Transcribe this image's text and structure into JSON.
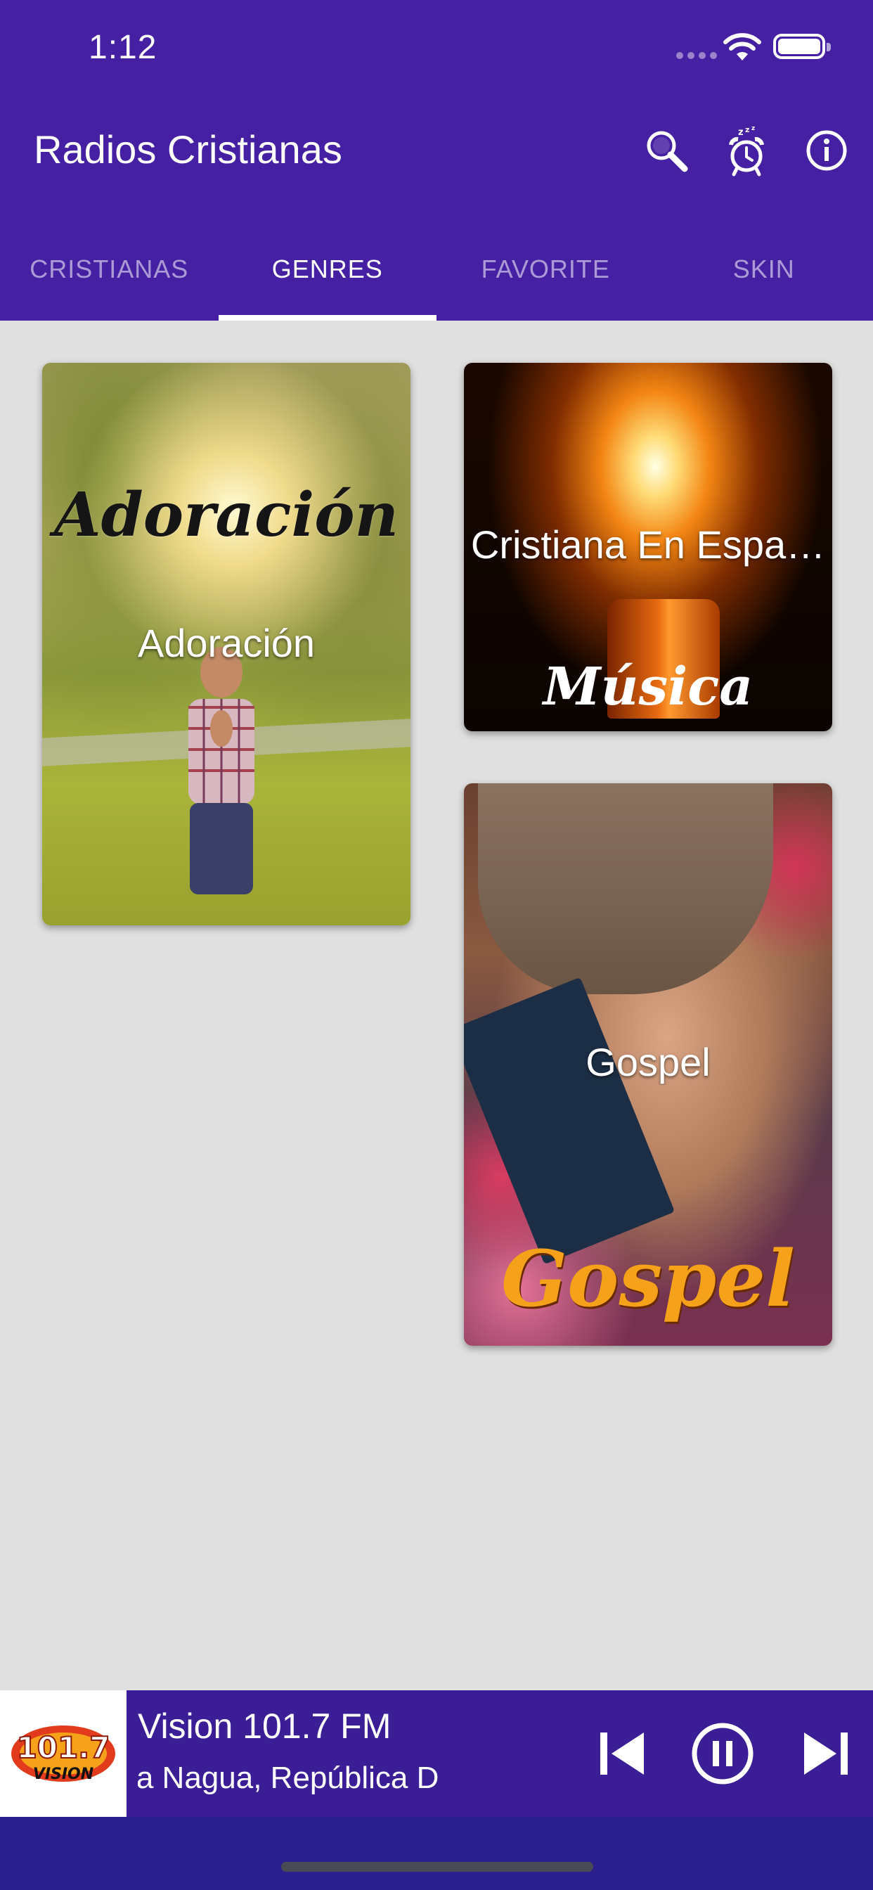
{
  "status_bar": {
    "time": "1:12"
  },
  "app_bar": {
    "title": "Radios Cristianas",
    "icons": [
      "search-icon",
      "sleep-timer-icon",
      "info-icon"
    ]
  },
  "tabs": [
    {
      "label": "CRISTIANAS",
      "active": false
    },
    {
      "label": "GENRES",
      "active": true
    },
    {
      "label": "FAVORITE",
      "active": false
    },
    {
      "label": "SKIN",
      "active": false
    }
  ],
  "genres": [
    {
      "label": "Adoración",
      "image_text": "Adoración"
    },
    {
      "label": "Cristiana En Espa…",
      "image_text": "Música"
    },
    {
      "label": "Gospel",
      "image_text": "Gospel"
    }
  ],
  "player": {
    "station": "Vision 101.7 FM",
    "location": "Dominicana    Nagua, República D",
    "logo_text": "101.7 VISION",
    "state": "playing"
  },
  "colors": {
    "primary": "#4520a2",
    "player_bg": "#3b1e96",
    "background": "#e0e0e0",
    "tab_inactive": "rgba(255,255,255,0.55)"
  }
}
